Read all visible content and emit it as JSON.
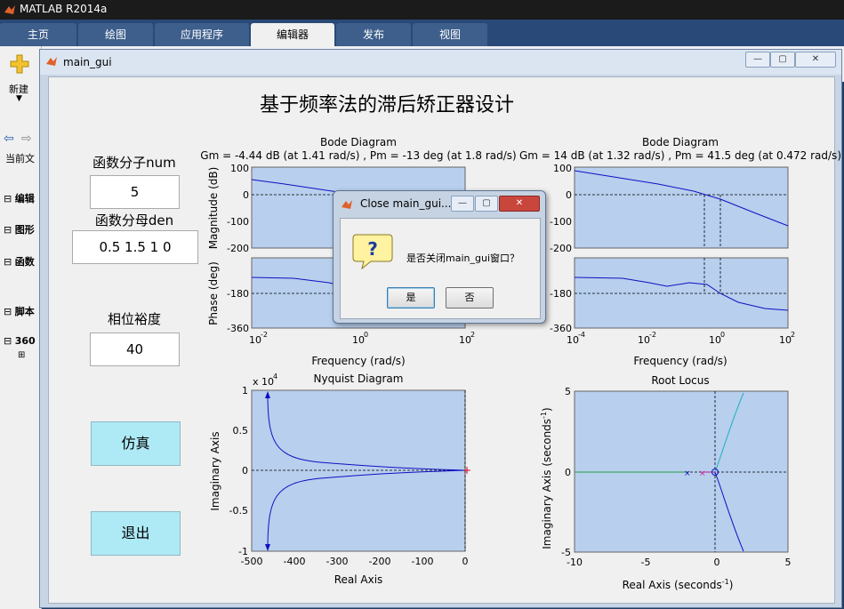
{
  "app": {
    "title": "MATLAB R2014a"
  },
  "ribbon": {
    "tabs": [
      "主页",
      "绘图",
      "应用程序",
      "编辑器",
      "发布",
      "视图"
    ],
    "active": "编辑器",
    "new_label": "新建"
  },
  "desktop": {
    "current_folder": "当前文",
    "sections": [
      "编辑",
      "图形",
      "函数",
      "脚本",
      "360"
    ]
  },
  "gui": {
    "window_title": "main_gui",
    "heading": "基于频率法的滞后矫正器设计",
    "num_label": "函数分子num",
    "num_value": "5",
    "den_label": "函数分母den",
    "den_value": "0.5 1.5 1 0",
    "phase_label": "相位裕度",
    "phase_value": "40",
    "sim_button": "仿真",
    "exit_button": "退出"
  },
  "plots": {
    "bode1": {
      "title": "Bode Diagram",
      "subtitle": "Gm = -4.44 dB (at 1.41 rad/s) ,  Pm = -13 deg (at 1.8 rad/s)",
      "mag_ylabel": "Magnitude (dB)",
      "phase_ylabel": "Phase (deg)",
      "xlabel": "Frequency  (rad/s)",
      "mag_ticks": [
        "100",
        "0",
        "-100",
        "-200"
      ],
      "phase_ticks": [
        "-180",
        "-360"
      ],
      "x_ticks": [
        "10",
        "10",
        "10"
      ],
      "x_exps": [
        "-2",
        "0",
        "2"
      ]
    },
    "bode2": {
      "title": "Bode Diagram",
      "subtitle": "Gm = 14 dB (at 1.32 rad/s) ,  Pm = 41.5 deg (at 0.472 rad/s)",
      "mag_ticks": [
        "100",
        "0",
        "-100",
        "-200"
      ],
      "phase_ticks": [
        "-180",
        "-360"
      ],
      "x_ticks": [
        "10",
        "10",
        "10",
        "10"
      ],
      "x_exps": [
        "-4",
        "-2",
        "0",
        "2"
      ],
      "xlabel": "Frequency  (rad/s)"
    },
    "nyquist": {
      "title": "Nyquist Diagram",
      "multiplier": "x 10",
      "multiplier_exp": "4",
      "ylabel": "Imaginary Axis",
      "xlabel": "Real Axis",
      "y_ticks": [
        "1",
        "0.5",
        "0",
        "-0.5",
        "-1"
      ],
      "x_ticks": [
        "-500",
        "-400",
        "-300",
        "-200",
        "-100",
        "0"
      ]
    },
    "rlocus": {
      "title": "Root Locus",
      "ylabel": "Imaginary Axis (seconds",
      "ylabel_exp": "-1",
      "xlabel": "Real Axis (seconds",
      "xlabel_exp": "-1",
      "y_ticks": [
        "5",
        "0",
        "-5"
      ],
      "x_ticks": [
        "-10",
        "-5",
        "0",
        "5"
      ]
    }
  },
  "dialog": {
    "title": "Close main_gui...",
    "message": "是否关闭main_gui窗口？",
    "yes_label": "是",
    "no_label": "否"
  },
  "colors": {
    "axes_bg": "#b8cfee",
    "curve": "#1010c0",
    "accent_button": "#aeeaf6"
  }
}
